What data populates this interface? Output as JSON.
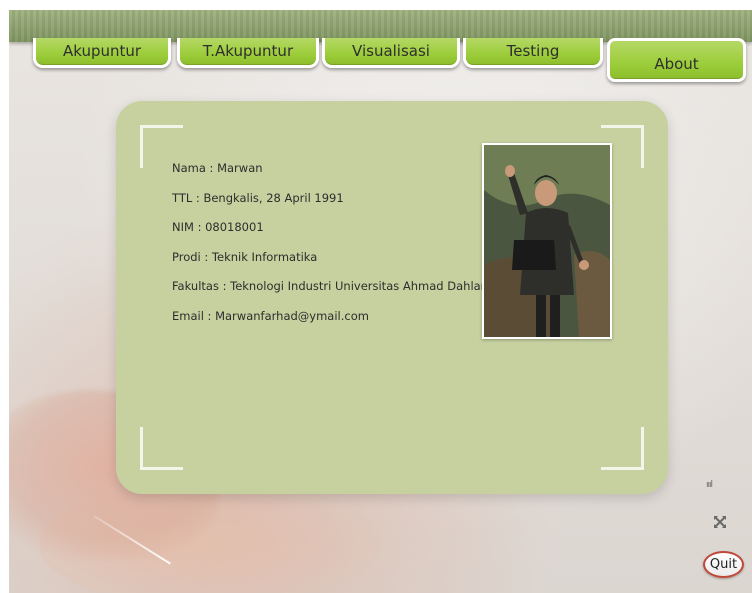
{
  "nav": {
    "tabs": [
      {
        "label": "Akupuntur"
      },
      {
        "label": "T.Akupuntur"
      },
      {
        "label": "Visualisasi"
      },
      {
        "label": "Testing"
      },
      {
        "label": "About"
      }
    ],
    "active": "About"
  },
  "profile": {
    "nama": "Nama : Marwan",
    "ttl": "TTL : Bengkalis, 28 April 1991",
    "nim": "NIM : 08018001",
    "prodi": "Prodi : Teknik Informatika",
    "fakultas": "Fakultas : Teknologi Industri Universitas Ahmad Dahlan",
    "email": "Email : Marwanfarhad@ymail.com"
  },
  "controls": {
    "sound_icon": "sound-bars-icon",
    "fullscreen_icon": "fullscreen-icon",
    "quit_label": "Quit"
  },
  "colors": {
    "tab_green": "#9ccd3a",
    "card_bg": "#c7d1a0",
    "topbar": "#8a9d6b",
    "quit_border": "#c0473a"
  }
}
